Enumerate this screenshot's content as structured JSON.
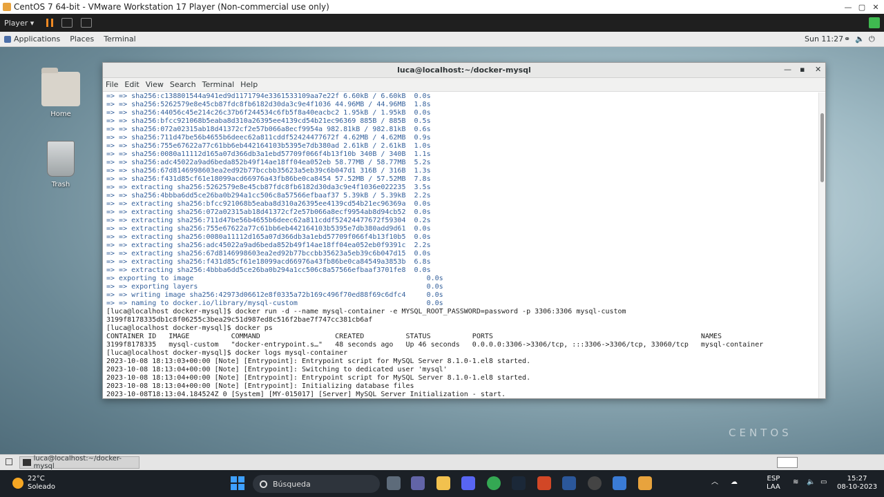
{
  "vmware": {
    "title": "CentOS 7 64-bit - VMware Workstation 17 Player (Non-commercial use only)",
    "player_menu": "Player ▾",
    "controls": [
      "—",
      "▢",
      "✕"
    ]
  },
  "gnome": {
    "menus": [
      "Applications",
      "Places",
      "Terminal"
    ],
    "clock": "Sun 11:27",
    "tray": [
      "⚭",
      "🔈",
      "⏻"
    ]
  },
  "desktop": {
    "icons": [
      {
        "label": "Home"
      },
      {
        "label": "Trash"
      }
    ],
    "watermark": "CENTOS"
  },
  "terminal": {
    "title": "luca@localhost:~/docker-mysql",
    "menu": [
      "File",
      "Edit",
      "View",
      "Search",
      "Terminal",
      "Help"
    ],
    "lines": [
      {
        "t": "=> => sha256:c138801544a941ed9d1171794e3361533109aa7e22f 6.60kB / 6.60kB  0.0s",
        "c": "b"
      },
      {
        "t": "=> => sha256:5262579e8e45cb87fdc8fb6182d30da3c9e4f1036 44.96MB / 44.96MB  1.8s",
        "c": "b"
      },
      {
        "t": "=> => sha256:44056c45e214c26c37b6f244534c6fb5f8a40eacbc2 1.95kB / 1.95kB  0.0s",
        "c": "b"
      },
      {
        "t": "=> => sha256:bfcc921068b5eaba8d310a26395ee4139cd54b21ec96369 885B / 885B  0.5s",
        "c": "b"
      },
      {
        "t": "=> => sha256:072a02315ab18d41372cf2e57b066a8ecf9954a 982.81kB / 982.81kB  0.6s",
        "c": "b"
      },
      {
        "t": "=> => sha256:711d47be56b4655b6deec62a811cddf52424477672f 4.62MB / 4.62MB  0.9s",
        "c": "b"
      },
      {
        "t": "=> => sha256:755e67622a77c61bb6eb442164103b5395e7db380ad 2.61kB / 2.61kB  1.0s",
        "c": "b"
      },
      {
        "t": "=> => sha256:0080a11112d165a07d366db3a1ebd57709f066f4b13f10b 340B / 340B  1.1s",
        "c": "b"
      },
      {
        "t": "=> => sha256:adc45022a9ad6beda852b49f14ae18ff04ea052eb 58.77MB / 58.77MB  5.2s",
        "c": "b"
      },
      {
        "t": "=> => sha256:67d8146998603ea2ed92b77bccbb35623a5eb39c6b047d1 316B / 316B  1.3s",
        "c": "b"
      },
      {
        "t": "=> => sha256:f431d85cf61e18099acd66976a43fb86be0ca8454 57.52MB / 57.52MB  7.8s",
        "c": "b"
      },
      {
        "t": "=> => extracting sha256:5262579e8e45cb87fdc8fb6182d30da3c9e4f1036e022235  3.5s",
        "c": "b"
      },
      {
        "t": "=> => sha256:4bbba6dd5ce26ba0b294a1cc506c8a57566efbaaf37 5.39kB / 5.39kB  2.2s",
        "c": "b"
      },
      {
        "t": "=> => extracting sha256:bfcc921068b5eaba8d310a26395ee4139cd54b21ec96369a  0.0s",
        "c": "b"
      },
      {
        "t": "=> => extracting sha256:072a02315ab18d41372cf2e57b066a8ecf9954ab8d94cb52  0.0s",
        "c": "b"
      },
      {
        "t": "=> => extracting sha256:711d47be56b4655b6deec62a811cddf52424477672f59304  0.2s",
        "c": "b"
      },
      {
        "t": "=> => extracting sha256:755e67622a77c61bb6eb442164103b5395e7db380add9d61  0.0s",
        "c": "b"
      },
      {
        "t": "=> => extracting sha256:0080a11112d165a07d366db3a1ebd57709f066f4b13f10b5  0.0s",
        "c": "b"
      },
      {
        "t": "=> => extracting sha256:adc45022a9ad6beda852b49f14ae18ff04ea052eb0f9391c  2.2s",
        "c": "b"
      },
      {
        "t": "=> => extracting sha256:67d8146998603ea2ed92b77bccbb35623a5eb39c6b047d15  0.0s",
        "c": "b"
      },
      {
        "t": "=> => extracting sha256:f431d85cf61e18099acd66976a43fb86be0ca84549a3853b  6.8s",
        "c": "b"
      },
      {
        "t": "=> => extracting sha256:4bbba6dd5ce26ba0b294a1cc506c8a57566efbaaf3701fe8  0.0s",
        "c": "b"
      },
      {
        "t": "=> exporting to image                                                        0.0s",
        "c": "b"
      },
      {
        "t": "=> => exporting layers                                                       0.0s",
        "c": "b"
      },
      {
        "t": "=> => writing image sha256:42973d06612e8f0335a72b169c496f70ed88f69c6dfc4     0.0s",
        "c": "b"
      },
      {
        "t": "=> => naming to docker.io/library/mysql-custom                               0.0s",
        "c": "b"
      },
      {
        "t": "[luca@localhost docker-mysql]$ docker run -d --name mysql-container -e MYSQL_ROOT_PASSWORD=password -p 3306:3306 mysql-custom",
        "c": ""
      },
      {
        "t": "3199f8178335db1c8f06255c3bea29c51d987ed8c516f2bae7f747cc381cb6af",
        "c": ""
      },
      {
        "t": "[luca@localhost docker-mysql]$ docker ps",
        "c": ""
      },
      {
        "t": "CONTAINER ID   IMAGE          COMMAND                  CREATED          STATUS          PORTS                                                  NAMES",
        "c": ""
      },
      {
        "t": "3199f8178335   mysql-custom   \"docker-entrypoint.s…\"   48 seconds ago   Up 46 seconds   0.0.0.0:3306->3306/tcp, :::3306->3306/tcp, 33060/tcp   mysql-container",
        "c": ""
      },
      {
        "t": "[luca@localhost docker-mysql]$ docker logs mysql-container",
        "c": ""
      },
      {
        "t": "2023-10-08 18:13:03+00:00 [Note] [Entrypoint]: Entrypoint script for MySQL Server 8.1.0-1.el8 started.",
        "c": ""
      },
      {
        "t": "2023-10-08 18:13:04+00:00 [Note] [Entrypoint]: Switching to dedicated user 'mysql'",
        "c": ""
      },
      {
        "t": "2023-10-08 18:13:04+00:00 [Note] [Entrypoint]: Entrypoint script for MySQL Server 8.1.0-1.el8 started.",
        "c": ""
      },
      {
        "t": "2023-10-08 18:13:04+00:00 [Note] [Entrypoint]: Initializing database files",
        "c": ""
      },
      {
        "t": "2023-10-08T18:13:04.184524Z 0 [System] [MY-015017] [Server] MySQL Server Initialization - start.",
        "c": ""
      }
    ]
  },
  "guest_taskbar": {
    "item_label": "luca@localhost:~/docker-mysql"
  },
  "host_taskbar": {
    "temp": "22°C",
    "condition": "Soleado",
    "search_placeholder": "Búsqueda",
    "lang": "ESP",
    "layout": "LAA",
    "time": "15:27",
    "date": "08-10-2023"
  }
}
